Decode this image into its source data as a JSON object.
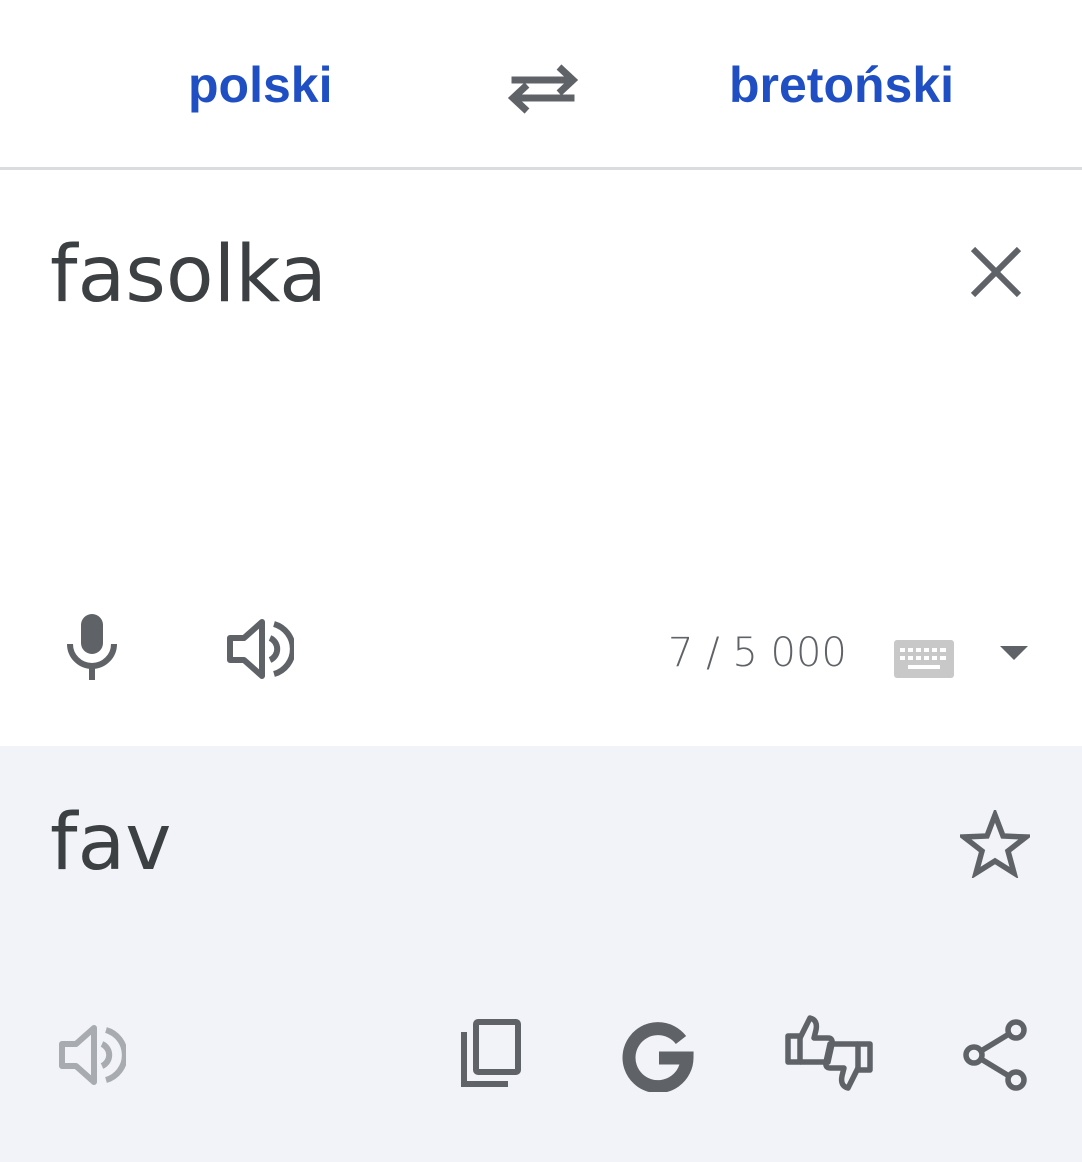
{
  "header": {
    "source_language": "polski",
    "target_language": "bretoński",
    "swap_icon": "swap-arrows-icon"
  },
  "input": {
    "text": "fasolka",
    "char_count": "7 / 5 000",
    "icons": [
      "close-icon",
      "microphone-icon",
      "speaker-icon",
      "keyboard-icon",
      "dropdown-arrow-icon"
    ]
  },
  "output": {
    "text": "fav",
    "icons": [
      "star-icon",
      "speaker-icon",
      "copy-icon",
      "google-icon",
      "feedback-thumbs-icon",
      "share-icon"
    ]
  },
  "colors": {
    "accent": "#1f4fc2",
    "icon": "#5f6368",
    "output_background": "#f1f3f8",
    "divider": "#dadce0"
  }
}
